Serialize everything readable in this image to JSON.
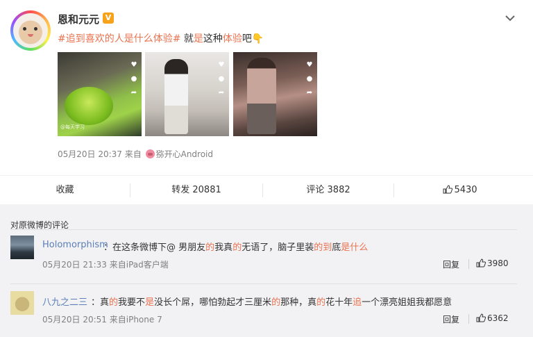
{
  "post": {
    "username": "恩和元元",
    "verified_badge": "V",
    "text": {
      "topic": "#追到喜欢的人是什么体验#",
      "part1": " 就",
      "hl1": "是",
      "part2": "这种",
      "hl2": "体验",
      "part3": "吧",
      "emoji": "👇"
    },
    "thumbnails": [
      {
        "caption": "@每天学习"
      },
      {
        "caption": ""
      },
      {
        "caption": ""
      }
    ],
    "meta": {
      "timestamp": "05月20日 20:37",
      "from": "来自",
      "source": "猕开心Android"
    }
  },
  "actions": {
    "favorite": "收藏",
    "repost": "转发 20881",
    "comment": "评论 3882",
    "like": "5430"
  },
  "comments_section": {
    "title": "对原微博的评论",
    "comments": [
      {
        "username": "Holomorphism",
        "colon": "：",
        "segments": [
          {
            "t": "在这条微博下@ 男朋友",
            "c": "n"
          },
          {
            "t": "的",
            "c": "r"
          },
          {
            "t": "我真",
            "c": "n"
          },
          {
            "t": "的",
            "c": "r"
          },
          {
            "t": "无语了，脑子里装",
            "c": "n"
          },
          {
            "t": "的到",
            "c": "r"
          },
          {
            "t": "底",
            "c": "n"
          },
          {
            "t": "是什么",
            "c": "r"
          }
        ],
        "time": "05月20日 21:33 来自iPad客户端",
        "reply": "回复",
        "likes": "3980"
      },
      {
        "username": "八九之二三",
        "colon": "：",
        "segments": [
          {
            "t": "真",
            "c": "n"
          },
          {
            "t": "的",
            "c": "r"
          },
          {
            "t": "我要不",
            "c": "n"
          },
          {
            "t": "是",
            "c": "r"
          },
          {
            "t": "没长个屌，哪怕勃起才三厘米",
            "c": "n"
          },
          {
            "t": "的",
            "c": "r"
          },
          {
            "t": "那种，真",
            "c": "n"
          },
          {
            "t": "的",
            "c": "r"
          },
          {
            "t": "花十年",
            "c": "n"
          },
          {
            "t": "追",
            "c": "r"
          },
          {
            "t": "一个漂亮姐姐我都愿意",
            "c": "n"
          }
        ],
        "time": "05月20日 20:51 来自iPhone 7",
        "reply": "回复",
        "likes": "6362"
      }
    ]
  },
  "colors": {
    "accent": "#eb7350",
    "username_link": "#5a7eb6",
    "badge": "#f7a21b"
  },
  "icons": [
    "chevron-down-icon",
    "thumbs-up-icon",
    "verified-v-icon",
    "pig-emoji-icon",
    "hand-point-down-icon"
  ]
}
